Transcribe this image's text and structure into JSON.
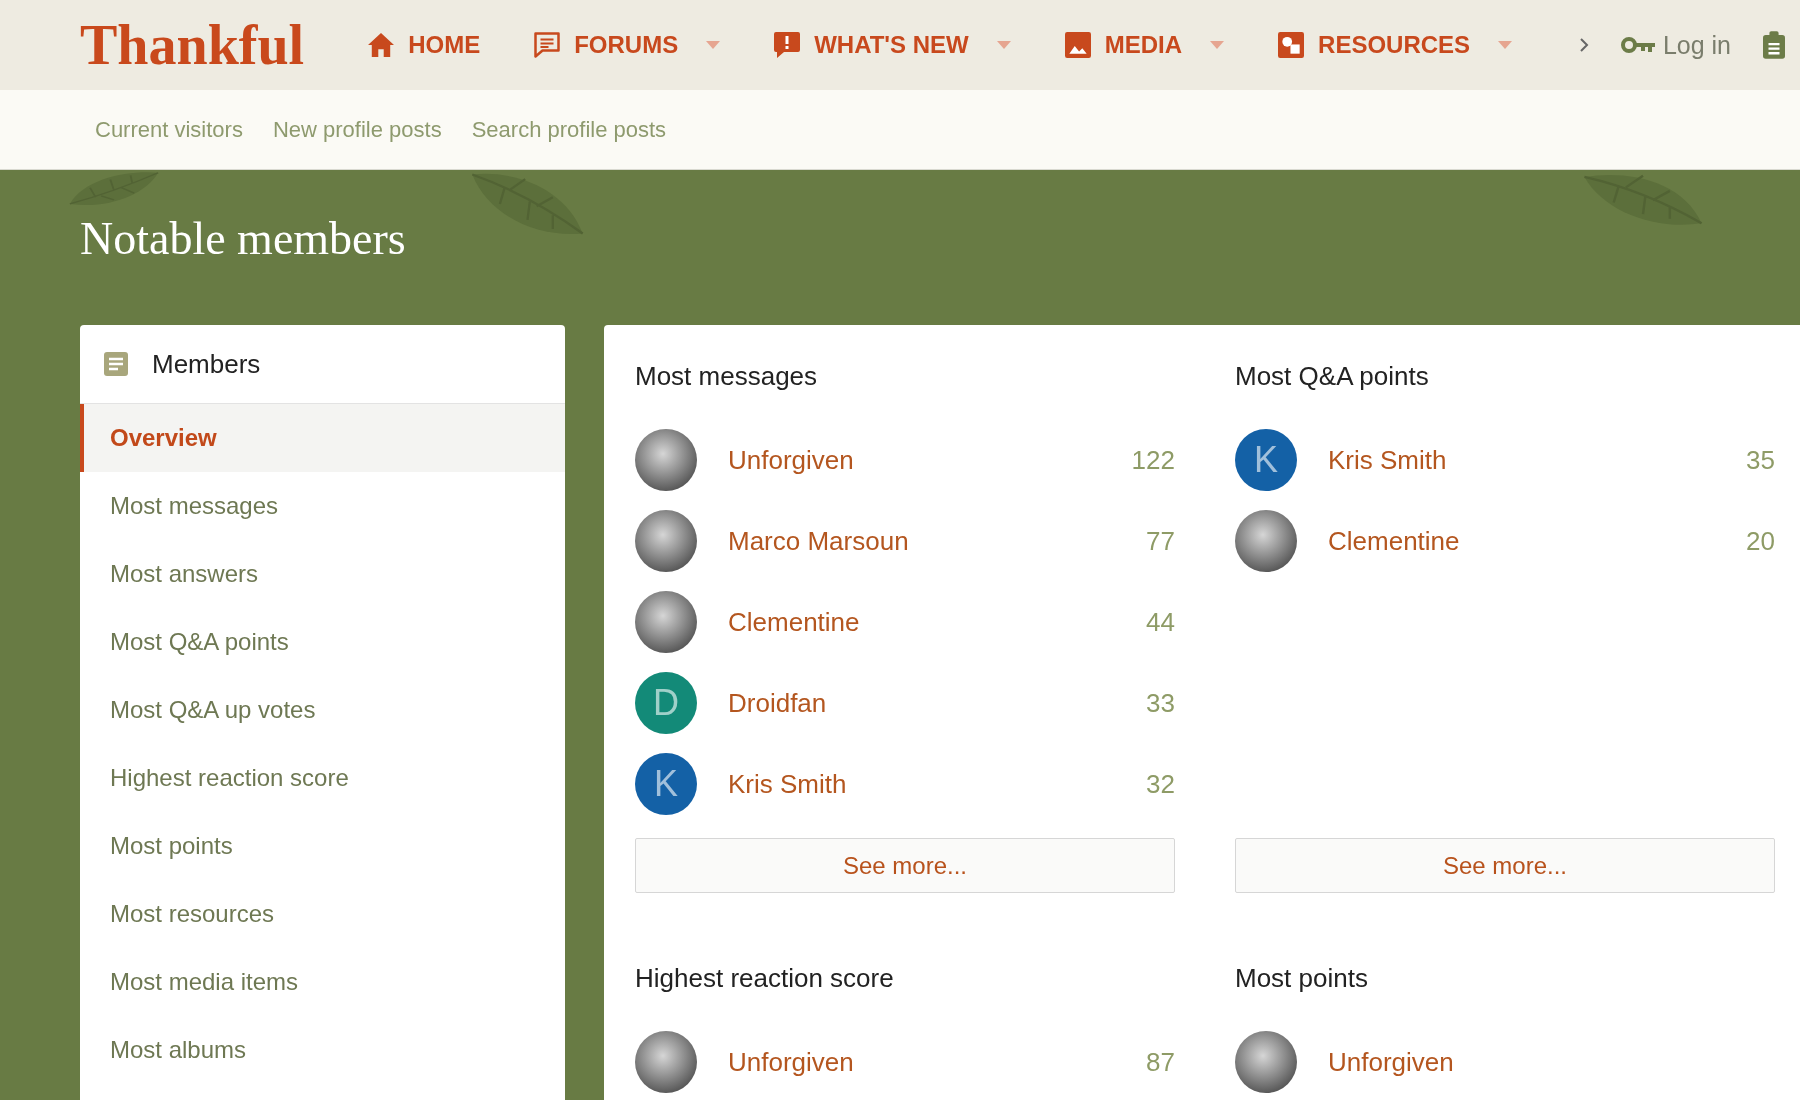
{
  "header": {
    "logo": "Thankful",
    "nav": [
      {
        "label": "HOME",
        "has_menu": false
      },
      {
        "label": "FORUMS",
        "has_menu": true
      },
      {
        "label": "WHAT'S NEW",
        "has_menu": true
      },
      {
        "label": "MEDIA",
        "has_menu": true
      },
      {
        "label": "RESOURCES",
        "has_menu": true
      }
    ],
    "login": "Log in"
  },
  "subnav": [
    "Current visitors",
    "New profile posts",
    "Search profile posts"
  ],
  "page_title": "Notable members",
  "sidebar": {
    "title": "Members",
    "items": [
      {
        "label": "Overview",
        "selected": true
      },
      {
        "label": "Most messages",
        "selected": false
      },
      {
        "label": "Most answers",
        "selected": false
      },
      {
        "label": "Most Q&A points",
        "selected": false
      },
      {
        "label": "Most Q&A up votes",
        "selected": false
      },
      {
        "label": "Highest reaction score",
        "selected": false
      },
      {
        "label": "Most points",
        "selected": false
      },
      {
        "label": "Most resources",
        "selected": false
      },
      {
        "label": "Most media items",
        "selected": false
      },
      {
        "label": "Most albums",
        "selected": false
      }
    ]
  },
  "panels": [
    {
      "title": "Most messages",
      "members": [
        {
          "name": "Unforgiven",
          "count": "122",
          "avatar": {
            "kind": "photo"
          }
        },
        {
          "name": "Marco Marsoun",
          "count": "77",
          "avatar": {
            "kind": "photo"
          }
        },
        {
          "name": "Clementine",
          "count": "44",
          "avatar": {
            "kind": "photo"
          }
        },
        {
          "name": "Droidfan",
          "count": "33",
          "avatar": {
            "kind": "letter",
            "letter": "D",
            "color": "#138a78"
          }
        },
        {
          "name": "Kris Smith",
          "count": "32",
          "avatar": {
            "kind": "letter",
            "letter": "K",
            "color": "#1461a6"
          }
        }
      ],
      "see_more": "See more..."
    },
    {
      "title": "Most Q&A points",
      "members": [
        {
          "name": "Kris Smith",
          "count": "35",
          "avatar": {
            "kind": "letter",
            "letter": "K",
            "color": "#1461a6"
          }
        },
        {
          "name": "Clementine",
          "count": "20",
          "avatar": {
            "kind": "photo"
          }
        }
      ],
      "see_more": "See more..."
    },
    {
      "title": "Highest reaction score",
      "members": [
        {
          "name": "Unforgiven",
          "count": "87",
          "avatar": {
            "kind": "photo"
          }
        }
      ]
    },
    {
      "title": "Most points",
      "members": [
        {
          "name": "Unforgiven",
          "avatar": {
            "kind": "photo"
          }
        }
      ]
    }
  ]
}
